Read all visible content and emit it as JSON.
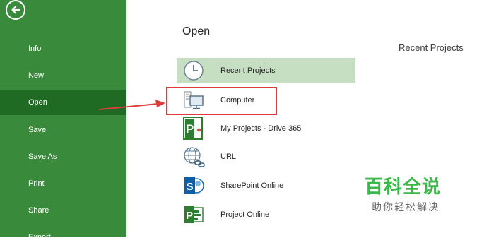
{
  "sidebar": {
    "items": [
      {
        "label": "Info"
      },
      {
        "label": "New"
      },
      {
        "label": "Open",
        "active": true
      },
      {
        "label": "Save"
      },
      {
        "label": "Save As"
      },
      {
        "label": "Print"
      },
      {
        "label": "Share"
      },
      {
        "label": "Export"
      }
    ],
    "back_icon": "back-arrow-icon"
  },
  "main": {
    "title": "Open",
    "right_title": "Recent Projects",
    "locations": [
      {
        "label": "Recent Projects",
        "icon": "clock-icon",
        "selected": true
      },
      {
        "label": "Computer",
        "icon": "computer-icon"
      },
      {
        "label": "My Projects - Drive 365",
        "icon": "project-file-icon"
      },
      {
        "label": "URL",
        "icon": "globe-link-icon"
      },
      {
        "label": "SharePoint Online",
        "icon": "sharepoint-icon"
      },
      {
        "label": "Project Online",
        "icon": "project-online-icon"
      }
    ]
  },
  "watermark": {
    "main": "百科全说",
    "sub": "助你轻松解决"
  },
  "colors": {
    "sidebar": "#3a8a3c",
    "sidebar_active": "#1f6b23",
    "selected_row": "#c6dfc3",
    "annotation": "#e03b3b",
    "watermark": "#3cb84a"
  }
}
